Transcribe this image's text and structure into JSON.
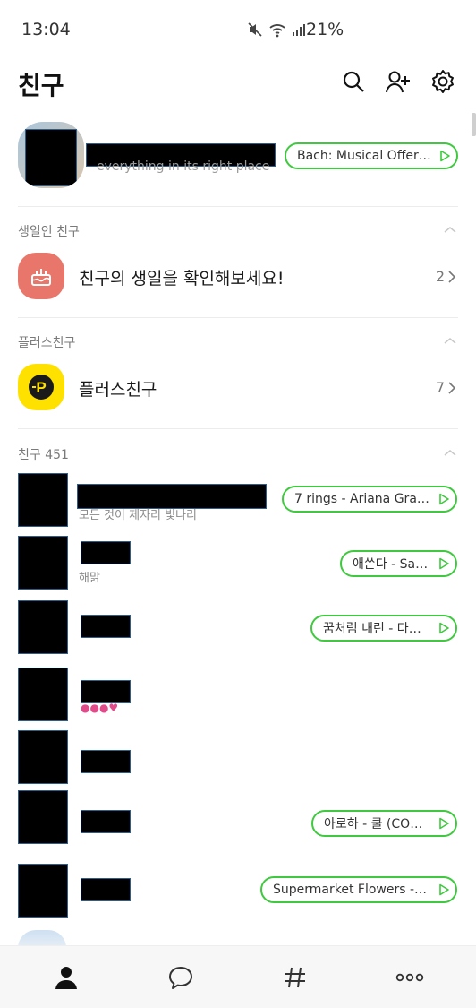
{
  "status_bar": {
    "time": "13:04",
    "battery": "21%"
  },
  "header": {
    "title": "친구"
  },
  "profile": {
    "status_message": "everything in its right place",
    "music": "Bach: Musical Offerin⋯"
  },
  "birthday": {
    "section_label": "생일인 친구",
    "title": "친구의 생일을 확인해보세요!",
    "count": "2"
  },
  "plus": {
    "section_label": "플러스친구",
    "title": "플러스친구",
    "count": "7"
  },
  "friends": {
    "section_label": "친구 451",
    "items": [
      {
        "status": "모든 것이 제자리 빛나리",
        "music": "7 rings - Ariana Grande"
      },
      {
        "status": "해맑",
        "music": "애쓴다 - San E"
      },
      {
        "status": "",
        "music": "꿈처럼 내린 - 다비치"
      },
      {
        "status": "",
        "music": ""
      },
      {
        "status": "",
        "music": ""
      },
      {
        "status": "",
        "music": "아로하 - 쿨 (COOL)"
      },
      {
        "status": "",
        "music": "Supermarket Flowers - E⋯"
      }
    ]
  },
  "colors": {
    "accent_green": "#3ec93e",
    "birthday_bg": "#e8766a",
    "plus_yellow": "#ffe100"
  }
}
